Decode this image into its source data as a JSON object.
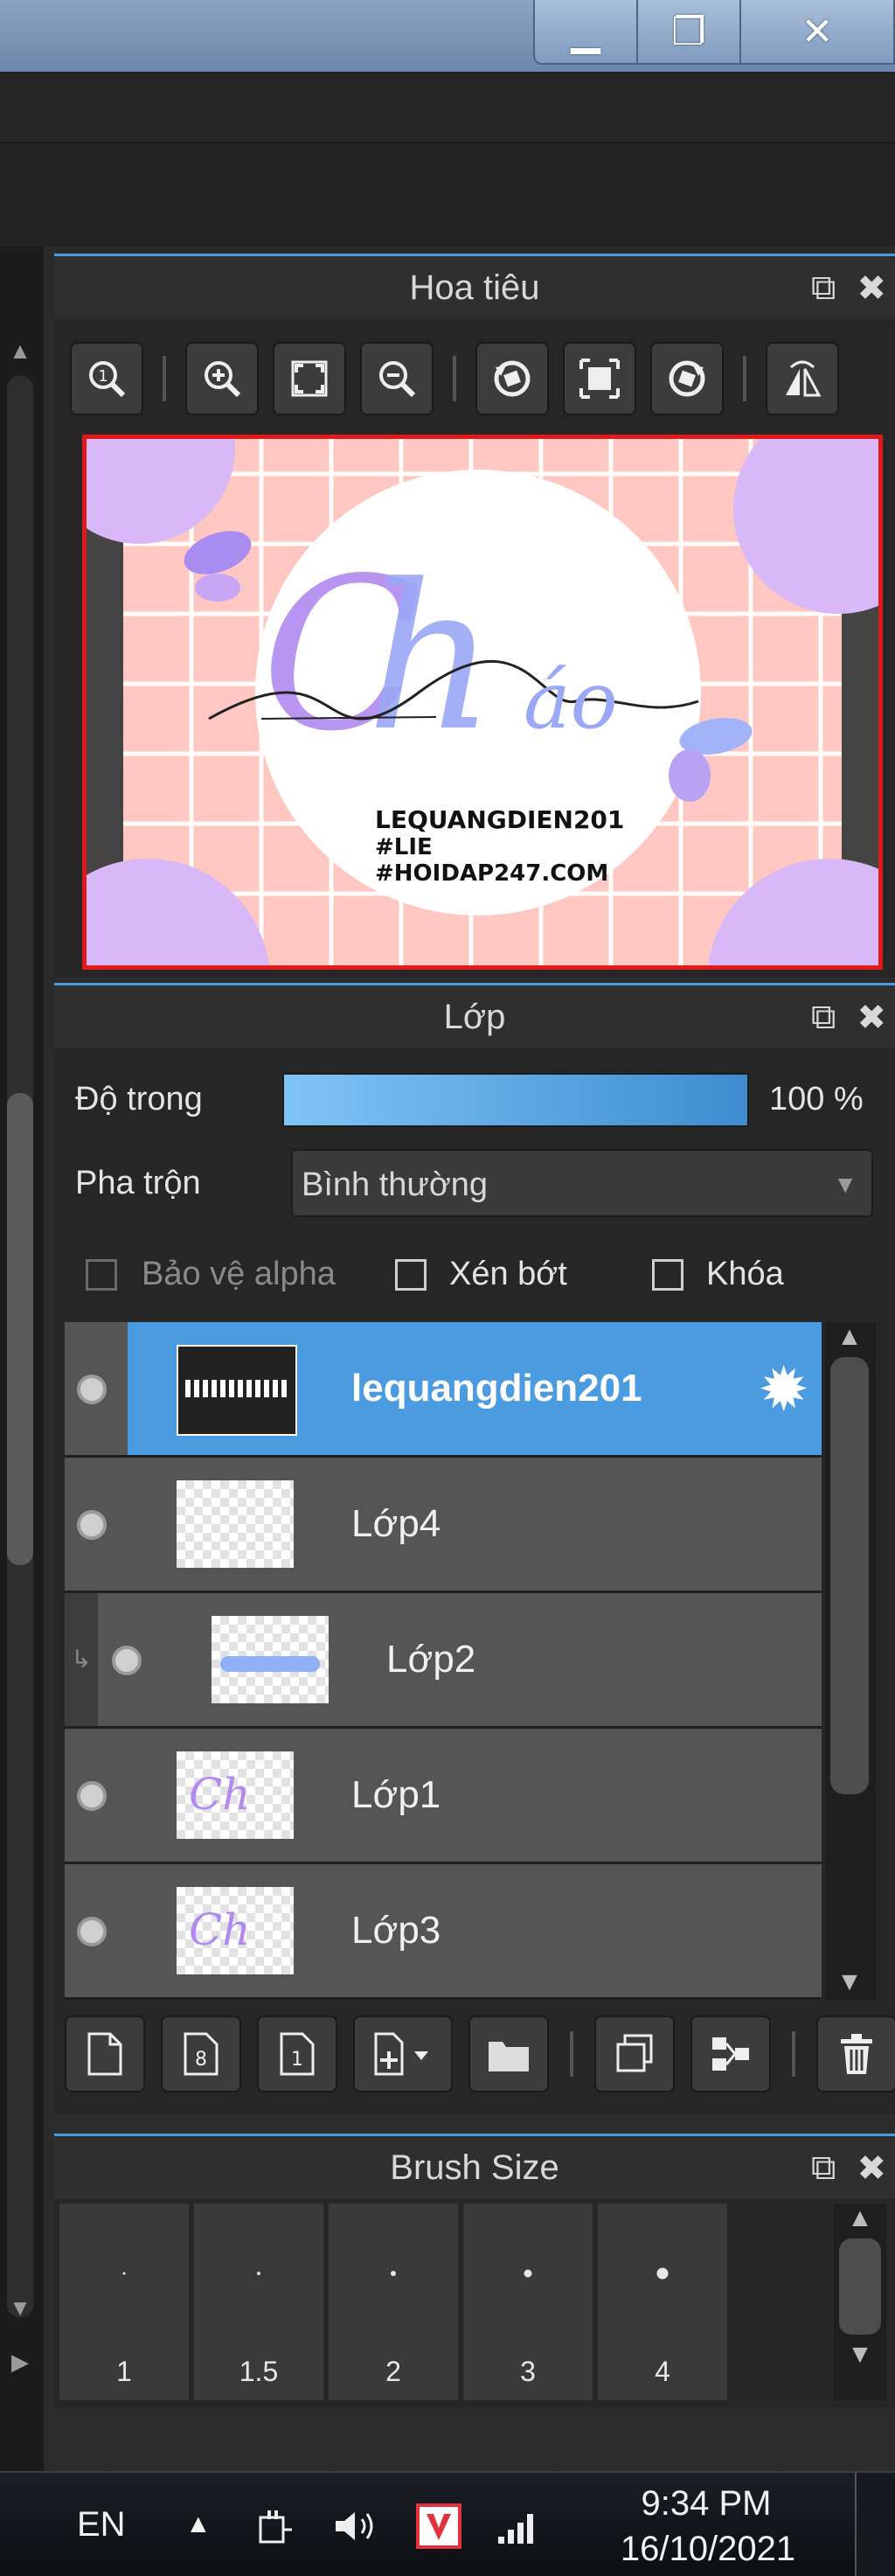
{
  "window": {
    "buttons": [
      "▁",
      "❐",
      "✕"
    ]
  },
  "navigator": {
    "title": "Hoa tiêu",
    "tools": [
      "zoom-100-icon",
      "zoom-in-icon",
      "fit-icon",
      "zoom-out-icon",
      "rotate-left-icon",
      "fit-window-icon",
      "rotate-right-icon",
      "flip-icon"
    ],
    "preview": {
      "line1": "LEQUANGDIEN201",
      "line2": "#LIE",
      "line3": "#HOIDAP247.COM"
    }
  },
  "layers_panel": {
    "title": "Lớp",
    "opacity_label": "Độ trong",
    "opacity_value": "100 %",
    "opacity_level": 1.0,
    "blend_label": "Pha trộn",
    "blend_value": "Bình thường",
    "protect_alpha": "Bảo vệ alpha",
    "clipping": "Xén bớt",
    "lock": "Khóa",
    "layers": [
      {
        "name": "lequangdien201",
        "selected": true
      },
      {
        "name": "Lớp4",
        "selected": false
      },
      {
        "name": "Lớp2",
        "selected": false,
        "clipped": true
      },
      {
        "name": "Lớp1",
        "selected": false
      },
      {
        "name": "Lớp3",
        "selected": false
      }
    ]
  },
  "brush_panel": {
    "title": "Brush Size",
    "sizes": [
      "1",
      "1.5",
      "2",
      "3",
      "4"
    ]
  },
  "taskbar": {
    "language": "EN",
    "time": "9:34 PM",
    "date": "16/10/2021"
  },
  "colors": {
    "accent": "#4a9be0",
    "preview_border": "#e01a1a",
    "preview_bg": "#ffc7c2"
  }
}
